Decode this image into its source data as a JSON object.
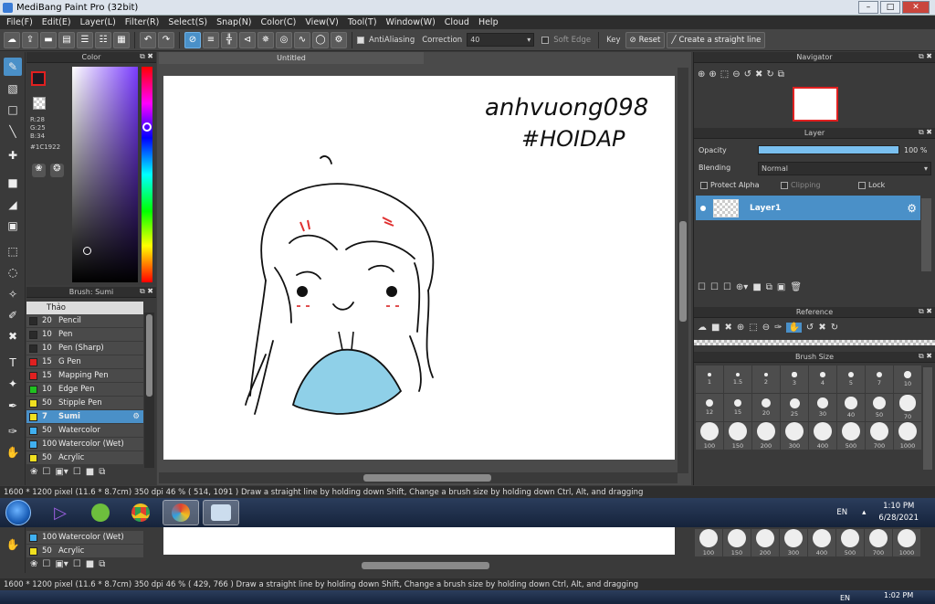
{
  "window": {
    "title": "MediBang Paint Pro (32bit)"
  },
  "menu": [
    "File(F)",
    "Edit(E)",
    "Layer(L)",
    "Filter(R)",
    "Select(S)",
    "Snap(N)",
    "Color(C)",
    "View(V)",
    "Tool(T)",
    "Window(W)",
    "Cloud",
    "Help"
  ],
  "toolbar": {
    "antialiasing_label": "AntiAliasing",
    "correction_label": "Correction",
    "correction_value": "40",
    "soft_edge_label": "Soft Edge",
    "key_label": "Key",
    "reset_label": "Reset",
    "straight_line_label": "Create a straight line"
  },
  "color_panel": {
    "title": "Color",
    "r": "R:28",
    "g": "G:25",
    "b": "B:34",
    "hex": "#1C1922",
    "fg_color": "#1C1922",
    "border_color": "#e02020"
  },
  "brush_panel": {
    "title": "Brush: Sumi",
    "group": "Thảo",
    "brushes": [
      {
        "size": "20",
        "name": "Pencil",
        "color": "#2a2a2a"
      },
      {
        "size": "10",
        "name": "Pen",
        "color": "#2a2a2a"
      },
      {
        "size": "10",
        "name": "Pen (Sharp)",
        "color": "#2a2a2a"
      },
      {
        "size": "15",
        "name": "G Pen",
        "color": "#e02020"
      },
      {
        "size": "15",
        "name": "Mapping Pen",
        "color": "#e02020"
      },
      {
        "size": "10",
        "name": "Edge Pen",
        "color": "#20c020"
      },
      {
        "size": "50",
        "name": "Stipple Pen",
        "color": "#f0e020"
      },
      {
        "size": "7",
        "name": "Sumi",
        "color": "#f0e020",
        "selected": true
      },
      {
        "size": "50",
        "name": "Watercolor",
        "color": "#40b0f0"
      },
      {
        "size": "100",
        "name": "Watercolor (Wet)",
        "color": "#40b0f0"
      },
      {
        "size": "50",
        "name": "Acrylic",
        "color": "#f0e020"
      }
    ]
  },
  "canvas": {
    "tab_title": "Untitled",
    "signature_line1": "anhvuong098",
    "signature_line2": "#HOIDAP"
  },
  "navigator": {
    "title": "Navigator"
  },
  "layer_panel": {
    "title": "Layer",
    "opacity_label": "Opacity",
    "opacity_value": "100 %",
    "opacity_fraction": 1.0,
    "blending_label": "Blending",
    "blending_value": "Normal",
    "protect_alpha_label": "Protect Alpha",
    "clipping_label": "Clipping",
    "lock_label": "Lock",
    "layer_name": "Layer1"
  },
  "reference_panel": {
    "title": "Reference"
  },
  "brush_size_panel": {
    "title": "Brush Size",
    "sizes": [
      "1",
      "1.5",
      "2",
      "3",
      "4",
      "5",
      "7",
      "10",
      "12",
      "15",
      "20",
      "25",
      "30",
      "40",
      "50",
      "70",
      "100",
      "150",
      "200",
      "300",
      "400",
      "500",
      "700",
      "1000"
    ]
  },
  "status": {
    "dimensions": "1600 * 1200 pixel",
    "physical": "(11.6 * 8.7cm)",
    "dpi": "350 dpi",
    "zoom": "46 %",
    "coords": "( 514, 1091 )",
    "hint": "Draw a straight line by holding down Shift, Change a brush size by holding down Ctrl, Alt, and dragging"
  },
  "taskbar": {
    "language": "EN",
    "time": "1:10 PM",
    "date": "6/28/2021"
  },
  "duplicate": {
    "brush_rows": [
      {
        "size": "100",
        "name": "Watercolor (Wet)",
        "color": "#40b0f0"
      },
      {
        "size": "50",
        "name": "Acrylic",
        "color": "#f0e020"
      }
    ],
    "sizes": [
      "100",
      "150",
      "200",
      "300",
      "400",
      "500",
      "700",
      "1000"
    ],
    "coords": "( 429, 766 )",
    "time": "1:02 PM",
    "language": "EN"
  }
}
